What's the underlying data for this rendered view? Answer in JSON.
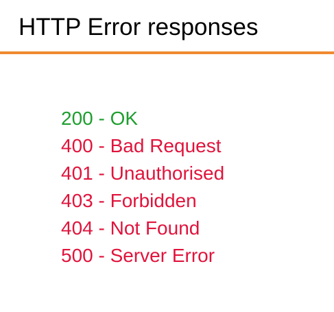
{
  "slide": {
    "title": "HTTP Error responses",
    "accent_color": "#f08a30"
  },
  "status_codes": [
    {
      "text": "200 - OK",
      "color": "#1e9e2e"
    },
    {
      "text": "400 - Bad Request",
      "color": "#e0143c"
    },
    {
      "text": "401 - Unauthorised",
      "color": "#e0143c"
    },
    {
      "text": "403 - Forbidden",
      "color": "#e0143c"
    },
    {
      "text": "404 - Not Found",
      "color": "#e0143c"
    },
    {
      "text": "500 - Server Error",
      "color": "#e0143c"
    }
  ]
}
